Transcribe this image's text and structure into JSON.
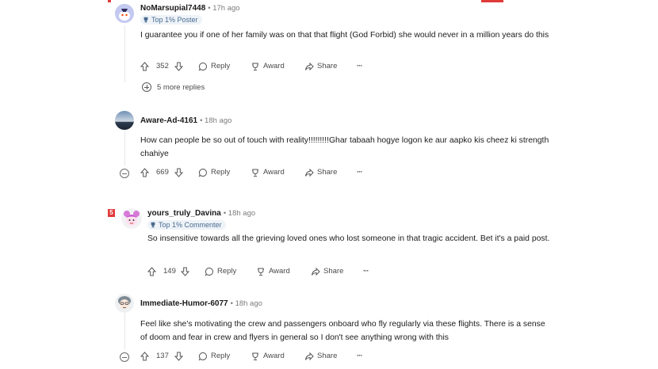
{
  "comments": [
    {
      "username": "NoMarsupial7448",
      "time": "17h ago",
      "badge": "Top 1% Poster",
      "body": "I guarantee you if one of her family was on that that flight (God Forbid) she would never in a million years do this",
      "votes": "352",
      "reply_label": "Reply",
      "award_label": "Award",
      "share_label": "Share",
      "more_label": "···",
      "more_replies": "5 more replies",
      "avatar_icon": "snoo-avatar-icon"
    },
    {
      "username": "Aware-Ad-4161",
      "time": "18h ago",
      "body": "How can people be so out of touch with reality!!!!!!!!!Ghar tabaah hogye logon ke aur aapko kis cheez ki strength chahiye",
      "votes": "669",
      "reply_label": "Reply",
      "award_label": "Award",
      "share_label": "Share",
      "more_label": "···",
      "avatar_icon": "landscape-avatar-icon"
    },
    {
      "username": "yours_truly_Davina",
      "time": "18h ago",
      "badge": "Top 1% Commenter",
      "body": "So insensitive towards all the grieving loved ones who lost someone in that tragic accident. Bet it's a paid post.",
      "votes": "149",
      "reply_label": "Reply",
      "award_label": "Award",
      "share_label": "Share",
      "more_label": "···",
      "marker": "5",
      "avatar_icon": "character-avatar-icon"
    },
    {
      "username": "Immediate-Humor-6077",
      "time": "18h ago",
      "body": "Feel like she's motivating the crew and passengers onboard who fly regularly via these flights. There is a sense of doom and fear in crew and flyers in general so I don't see anything wrong with this",
      "votes": "137",
      "reply_label": "Reply",
      "award_label": "Award",
      "share_label": "Share",
      "more_label": "···",
      "avatar_icon": "character-avatar-icon"
    }
  ],
  "colors": {
    "accent_red": "#e03a3a",
    "badge_text": "#4b6b8f",
    "badge_bg": "#eef3f8",
    "meta_text": "#7c7c7c"
  }
}
